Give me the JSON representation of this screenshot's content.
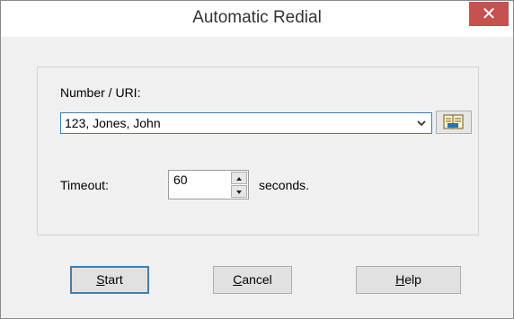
{
  "window": {
    "title": "Automatic Redial",
    "close_glyph": "✕"
  },
  "number": {
    "label": "Number / URI:",
    "value": "123, Jones, John",
    "dropdown_icon": "chevron-down-icon",
    "address_book_icon": "address-book-icon"
  },
  "timeout": {
    "label": "Timeout:",
    "value": "60",
    "unit": "seconds."
  },
  "buttons": {
    "start": {
      "mnemonic": "S",
      "rest": "tart"
    },
    "cancel": {
      "mnemonic": "C",
      "rest": "ancel"
    },
    "help": {
      "mnemonic": "H",
      "rest": "elp"
    }
  },
  "colors": {
    "close_button": "#c75050",
    "focus_border": "#3c7fb1"
  }
}
